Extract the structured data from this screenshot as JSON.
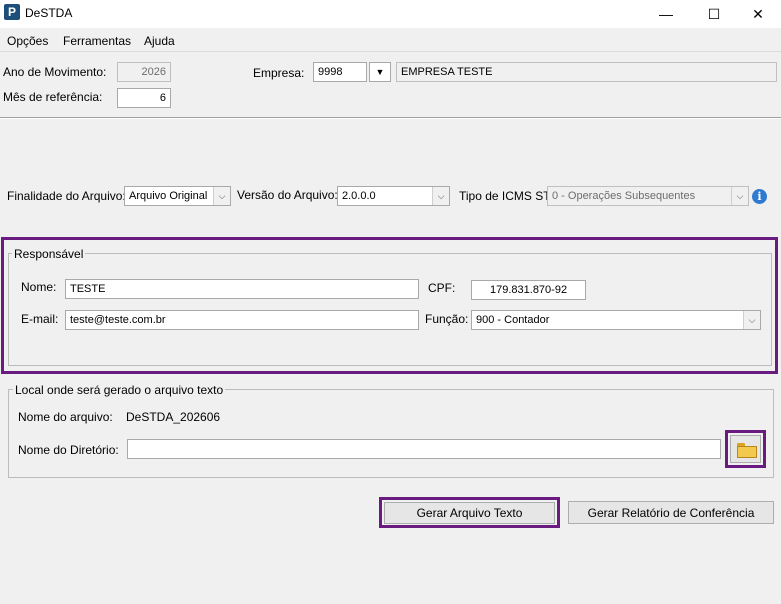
{
  "window": {
    "title": "DeSTDA",
    "icon": "P",
    "minimize": "—",
    "maximize": "☐",
    "close": "✕"
  },
  "menu": {
    "items": [
      "Opções",
      "Ferramentas",
      "Ajuda"
    ]
  },
  "header": {
    "ano_label": "Ano de Movimento:",
    "ano_value": "2026",
    "mes_label": "Mês de referência:",
    "mes_value": "6",
    "empresa_label": "Empresa:",
    "empresa_code": "9998",
    "empresa_name": "EMPRESA TESTE"
  },
  "options": {
    "finalidade_label": "Finalidade do Arquivo:",
    "finalidade_value": "Arquivo Original",
    "versao_label": "Versão do Arquivo:",
    "versao_value": "2.0.0.0",
    "icms_label": "Tipo de ICMS ST:",
    "icms_value": "0 - Operações Subsequentes"
  },
  "responsavel": {
    "title": "Responsável",
    "nome_label": "Nome:",
    "nome_value": "TESTE",
    "cpf_label": "CPF:",
    "cpf_value": "179.831.870-92",
    "email_label": "E-mail:",
    "email_value": "teste@teste.com.br",
    "funcao_label": "Função:",
    "funcao_value": "900 - Contador"
  },
  "local": {
    "title": "Local onde será gerado o arquivo texto",
    "arquivo_label": "Nome do arquivo:",
    "arquivo_value": "DeSTDA_202606",
    "diretorio_label": "Nome do Diretório:",
    "diretorio_value": ""
  },
  "actions": {
    "gerar_texto": "Gerar Arquivo Texto",
    "gerar_relatorio": "Gerar Relatório de Conferência"
  },
  "colors": {
    "highlight": "#6a1b7f",
    "info": "#2f7ad1",
    "folder": "#f2c94c"
  }
}
